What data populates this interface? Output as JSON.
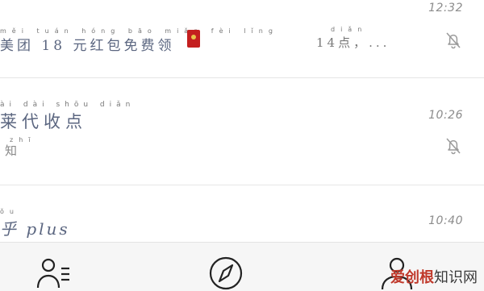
{
  "conversations": [
    {
      "time": "12:32",
      "pinyin": "měi tuán      hóng bāo miǎn fèi lǐng",
      "message": "美团 18 元红包免费领",
      "preview": "14点，...",
      "preview_pinyin": "diǎn",
      "muted": true,
      "icon": "red-envelope-icon"
    },
    {
      "time": "10:26",
      "title_pinyin": "ài  dài  shōu diǎn",
      "title": "莱代收点",
      "sub_pinyin": "zhī",
      "subtitle": "知",
      "muted": true
    },
    {
      "time": "10:40",
      "title_pinyin": "ǒu",
      "title": "乎 plus"
    }
  ],
  "tabbar": {
    "icons": [
      "contacts-icon",
      "discover-compass-icon",
      "profile-icon"
    ]
  },
  "watermark": {
    "brand": "爱创根",
    "rest": "知识网"
  }
}
